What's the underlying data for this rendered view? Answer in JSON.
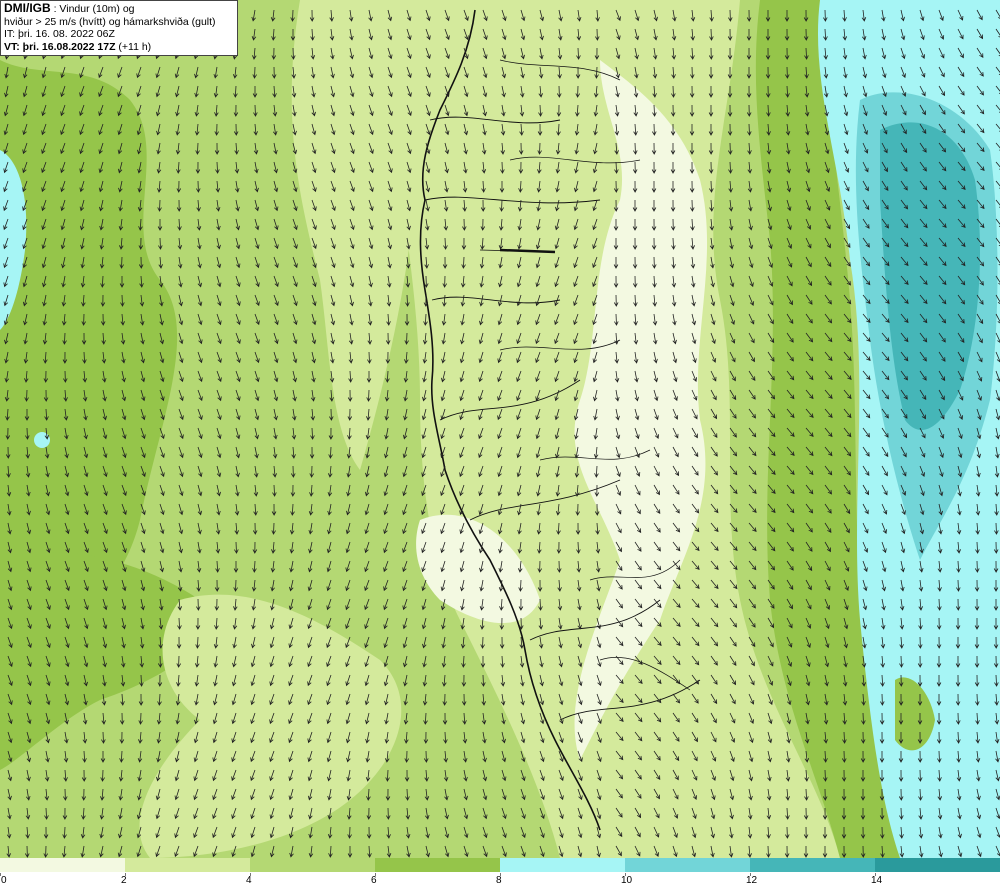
{
  "info": {
    "line1_bold": "DMI/IGB",
    "line1_rest": " : Vindur (10m) og",
    "line2": "hviður > 25 m/s (hvítt) og hámarkshviða (gult)",
    "line3": "IT: þri. 16. 08. 2022 06Z",
    "line4_bold": "VT: þri. 16.08.2022 17Z",
    "line4_rest": " (+11 h)"
  },
  "legend": {
    "bins": [
      {
        "label": "0",
        "color": "#ffffff"
      },
      {
        "label": "2",
        "color": "#f3f9e1"
      },
      {
        "label": "4",
        "color": "#d4ea9c"
      },
      {
        "label": "6",
        "color": "#b4d873"
      },
      {
        "label": "8",
        "color": "#95c54a"
      },
      {
        "label": "10",
        "color": "#a6f5f5"
      },
      {
        "label": "12",
        "color": "#72d5d8"
      },
      {
        "label": "14",
        "color": "#45b6b8"
      },
      {
        "label": "",
        "color": "#2a9a9c"
      }
    ]
  },
  "colors": {
    "calm": "#f3f9e1",
    "light": "#d4ea9c",
    "mid": "#b4d873",
    "strong": "#95c54a",
    "cyan1": "#a6f5f5",
    "cyan2": "#72d5d8",
    "cyan3": "#45b6b8",
    "coast": "#111111",
    "arrow": "#222222"
  }
}
